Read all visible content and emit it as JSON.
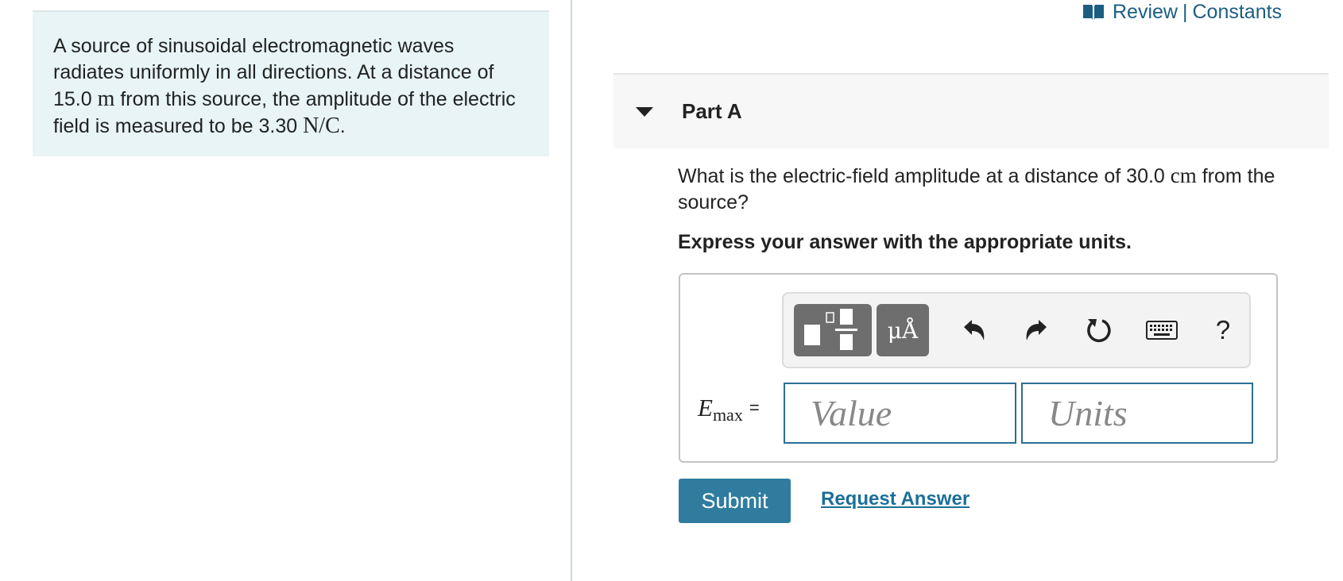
{
  "problem": {
    "text_1": "A source of sinusoidal electromagnetic waves radiates uniformly in all directions. At a distance of 15.0 ",
    "unit_m": "m",
    "text_2": " from this source, the amplitude of the electric field is measured to be 3.30 ",
    "unit_nc": "N/C",
    "text_3": "."
  },
  "header_links": {
    "review": "Review",
    "separator": "|",
    "constants": "Constants"
  },
  "part": {
    "title": "Part A",
    "question_1": "What is the electric-field amplitude at a distance of 30.0 ",
    "question_unit": "cm",
    "question_2": " from the source?",
    "instruction": "Express your answer with the appropriate units."
  },
  "toolbar": {
    "units_label": "μÅ",
    "help_label": "?"
  },
  "answer": {
    "variable": "E",
    "subscript": "max",
    "equals": "=",
    "value_placeholder": "Value",
    "units_placeholder": "Units"
  },
  "actions": {
    "submit_label": "Submit",
    "request_answer_label": "Request Answer"
  },
  "colors": {
    "problem_bg": "#e8f4f6",
    "accent": "#2f7c9f",
    "link": "#1b6f98"
  }
}
